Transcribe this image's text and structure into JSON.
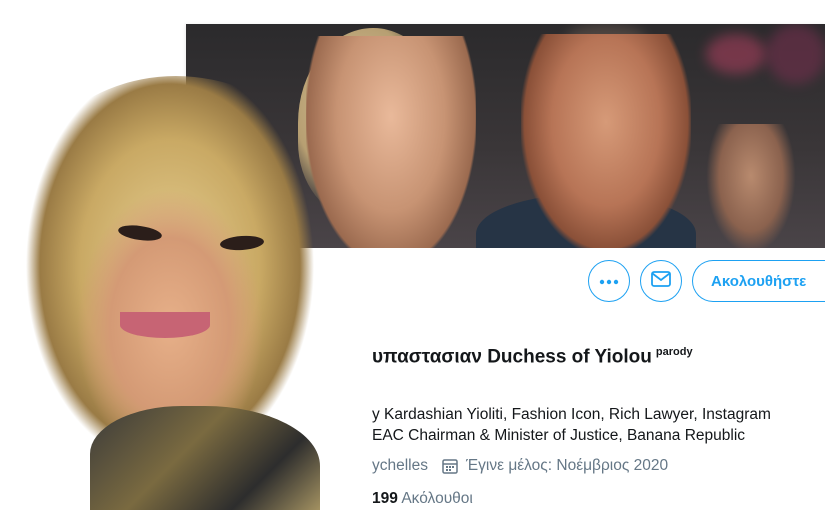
{
  "profile": {
    "display_name": "υπαστασιαν Duchess of Yiolou",
    "badge": "parody",
    "bio_line1": "y Kardashian Yioliti, Fashion Icon, Rich Lawyer, Instagram",
    "bio_line2": "EAC Chairman & Minister of Justice, Banana Republic",
    "location": "ychelles",
    "joined": "Έγινε μέλος: Νοέμβριος 2020",
    "following_count": "199",
    "following_label": "Ακόλουθοι"
  },
  "actions": {
    "more_icon": "ellipsis-icon",
    "message_icon": "envelope-icon",
    "follow_label": "Ακολουθήστε"
  },
  "colors": {
    "accent": "#1da1f2",
    "text": "#14171a",
    "muted": "#657786"
  }
}
